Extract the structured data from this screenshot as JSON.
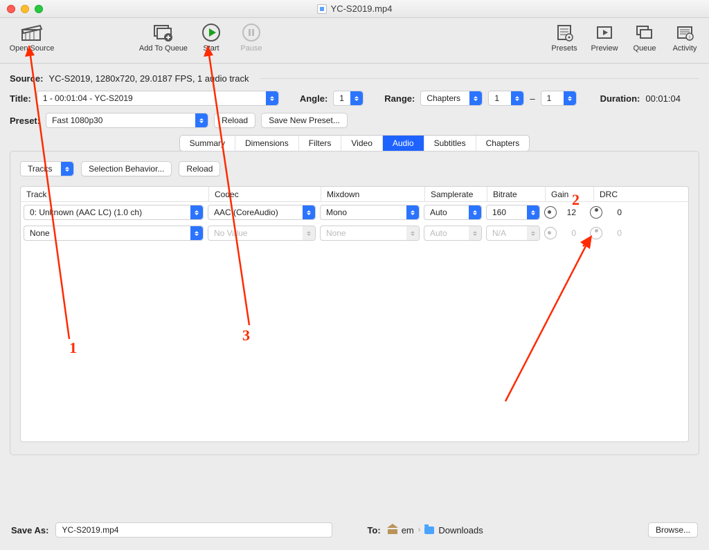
{
  "window": {
    "title": "YC-S2019.mp4"
  },
  "toolbar": {
    "open_source": "Open Source",
    "add_to_queue": "Add To Queue",
    "start": "Start",
    "pause": "Pause",
    "presets": "Presets",
    "preview": "Preview",
    "queue": "Queue",
    "activity": "Activity"
  },
  "source": {
    "label": "Source:",
    "value": "YC-S2019, 1280x720, 29.0187 FPS, 1 audio track"
  },
  "title": {
    "label": "Title:",
    "value": "1 - 00:01:04 - YC-S2019"
  },
  "angle": {
    "label": "Angle:",
    "value": "1"
  },
  "range": {
    "label": "Range:",
    "type": "Chapters",
    "from": "1",
    "dash": "–",
    "to": "1"
  },
  "duration": {
    "label": "Duration:",
    "value": "00:01:04"
  },
  "preset": {
    "label": "Preset:",
    "value": "Fast 1080p30",
    "reload": "Reload",
    "save_new": "Save New Preset..."
  },
  "tabs": [
    "Summary",
    "Dimensions",
    "Filters",
    "Video",
    "Audio",
    "Subtitles",
    "Chapters"
  ],
  "active_tab": "Audio",
  "audio_panel": {
    "tracks_btn": "Tracks",
    "selection_behavior": "Selection Behavior...",
    "reload": "Reload",
    "headers": {
      "track": "Track",
      "codec": "Codec",
      "mixdown": "Mixdown",
      "samplerate": "Samplerate",
      "bitrate": "Bitrate",
      "gain": "Gain",
      "drc": "DRC"
    },
    "rows": [
      {
        "track": "0: Unknown (AAC LC) (1.0 ch)",
        "codec": "AAC (CoreAudio)",
        "mixdown": "Mono",
        "samplerate": "Auto",
        "bitrate": "160",
        "gain": "12",
        "drc": "0",
        "disabled": false
      },
      {
        "track": "None",
        "codec": "No Value",
        "mixdown": "None",
        "samplerate": "Auto",
        "bitrate": "N/A",
        "gain": "0",
        "drc": "0",
        "disabled": true
      }
    ]
  },
  "save_as": {
    "label": "Save As:",
    "value": "YC-S2019.mp4",
    "to_label": "To:",
    "path_user": "em",
    "path_folder": "Downloads",
    "browse": "Browse..."
  },
  "annotations": {
    "n1": "1",
    "n2": "2",
    "n3": "3"
  }
}
